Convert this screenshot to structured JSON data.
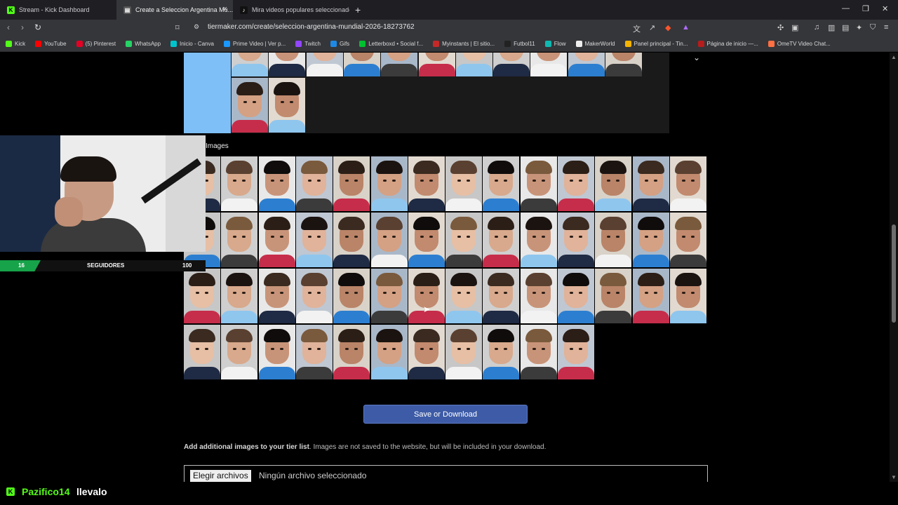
{
  "browser": {
    "tabs": [
      {
        "title": "Stream - Kick Dashboard",
        "favicon": "kick-icon",
        "color": "#53fc18",
        "active": false
      },
      {
        "title": "Create a Seleccion Argentina Mu...",
        "favicon": "tiermaker-icon",
        "color": "#3a3a3a",
        "active": true
      },
      {
        "title": "Mira videos populares seleccionados...",
        "favicon": "tiktok-icon",
        "color": "#111111",
        "active": false
      }
    ],
    "new_tab": "+",
    "url": "tiermaker.com/create/seleccion-argentina-mundial-2026-18273762",
    "bookmarks": [
      {
        "label": "Kick",
        "color": "#53fc18"
      },
      {
        "label": "YouTube",
        "color": "#ff0000"
      },
      {
        "label": "(5) Pinterest",
        "color": "#e60023"
      },
      {
        "label": "WhatsApp",
        "color": "#25d366"
      },
      {
        "label": "Inicio - Canva",
        "color": "#00c4cc"
      },
      {
        "label": "Prime Video | Ver p...",
        "color": "#1a98ff"
      },
      {
        "label": "Twitch",
        "color": "#9146ff"
      },
      {
        "label": "Gifs",
        "color": "#1e88e5"
      },
      {
        "label": "Letterboxd • Social f...",
        "color": "#00c030"
      },
      {
        "label": "Myinstants | El sitio...",
        "color": "#c62828"
      },
      {
        "label": "Futbol11",
        "color": "#222222"
      },
      {
        "label": "Flow",
        "color": "#0fb9b1"
      },
      {
        "label": "MakerWorld",
        "color": "#eeeeee"
      },
      {
        "label": "Panel principal - Tin...",
        "color": "#f4b400"
      },
      {
        "label": "Página de inicio —...",
        "color": "#b71c1c"
      },
      {
        "label": "OmeTV Video Chat...",
        "color": "#ff7043"
      }
    ]
  },
  "tier_row": {
    "label_color": "#7fbff7",
    "chevron": "⌄"
  },
  "images_title": "Images",
  "webcam": {
    "followers_count": "16",
    "followers_label": "SEGUIDORES",
    "followers_goal": "100"
  },
  "save_button": "Save or Download",
  "add_images": {
    "bold": "Add additional images to your tier list",
    "rest": ". Images are not saved to the website, but will be included in your download."
  },
  "file_input": {
    "button": "Elegir archivos",
    "status": "Ningún archivo seleccionado"
  },
  "chat": {
    "user": "Pazifico14",
    "message": "llevalo"
  }
}
